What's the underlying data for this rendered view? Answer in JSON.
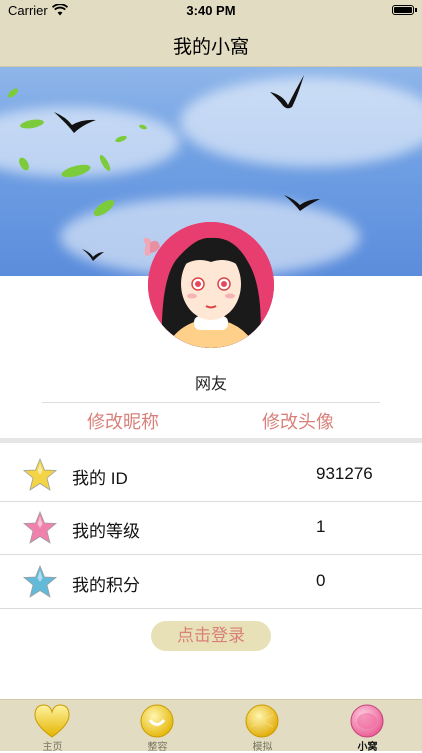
{
  "status_bar": {
    "carrier": "Carrier",
    "time": "3:40 PM"
  },
  "nav": {
    "title": "我的小窩"
  },
  "profile": {
    "nickname": "网友",
    "edit_nickname": "修改昵称",
    "edit_avatar": "修改头像"
  },
  "info_rows": [
    {
      "label": "我的 ID",
      "value": "931276",
      "star_color": "#f2d23a"
    },
    {
      "label": "我的等级",
      "value": "1",
      "star_color": "#f07aa8"
    },
    {
      "label": "我的积分",
      "value": "0",
      "star_color": "#5ab7d6"
    }
  ],
  "login_button": "点击登录",
  "tabs": [
    {
      "label": "主页",
      "icon": "heart-icon"
    },
    {
      "label": "整容",
      "icon": "smile-icon"
    },
    {
      "label": "模拟",
      "icon": "gold-circle-icon"
    },
    {
      "label": "小窝",
      "icon": "pink-circle-icon",
      "active": true
    }
  ]
}
